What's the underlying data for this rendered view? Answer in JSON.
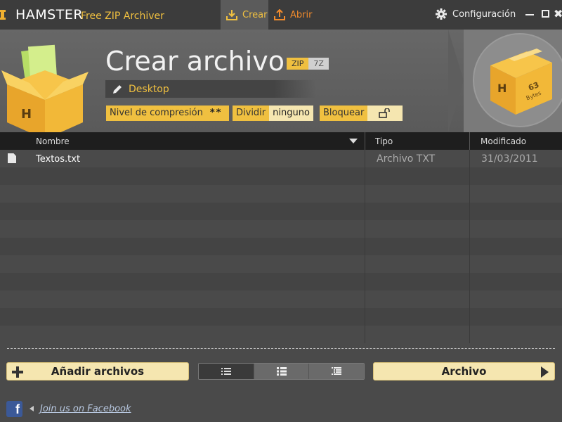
{
  "app": {
    "brand": "HAMSTER",
    "subtitle": "Free ZIP Archiver"
  },
  "tabs": [
    {
      "label": "Crear",
      "icon": "download-icon",
      "active": true
    },
    {
      "label": "Abrir",
      "icon": "upload-icon",
      "active": false
    }
  ],
  "settings": {
    "label": "Configuración",
    "icon": "gear-icon"
  },
  "header": {
    "title": "Crear archivo",
    "formats": [
      "ZIP",
      "7Z"
    ],
    "selected_format": "ZIP",
    "path": "Desktop",
    "size_label": "63",
    "size_unit": "Bytes"
  },
  "options": {
    "compression": {
      "label": "Nivel de compresión",
      "value": "**"
    },
    "split": {
      "label": "Dividir",
      "value": "ninguno"
    },
    "lock": {
      "label": "Bloquear",
      "icon": "unlocked-padlock-icon"
    }
  },
  "table": {
    "columns": [
      "Nombre",
      "Tipo",
      "Modificado"
    ],
    "rows": [
      {
        "name": "Textos.txt",
        "type": "Archivo TXT",
        "modified": "31/03/2011"
      }
    ]
  },
  "footer": {
    "add_files": "Añadir archivos",
    "archive": "Archivo",
    "facebook": "Join us on Facebook"
  },
  "colors": {
    "accent": "#f0c040",
    "orange": "#f08a2c",
    "button": "#f5e6b0",
    "facebook": "#3b5998"
  }
}
